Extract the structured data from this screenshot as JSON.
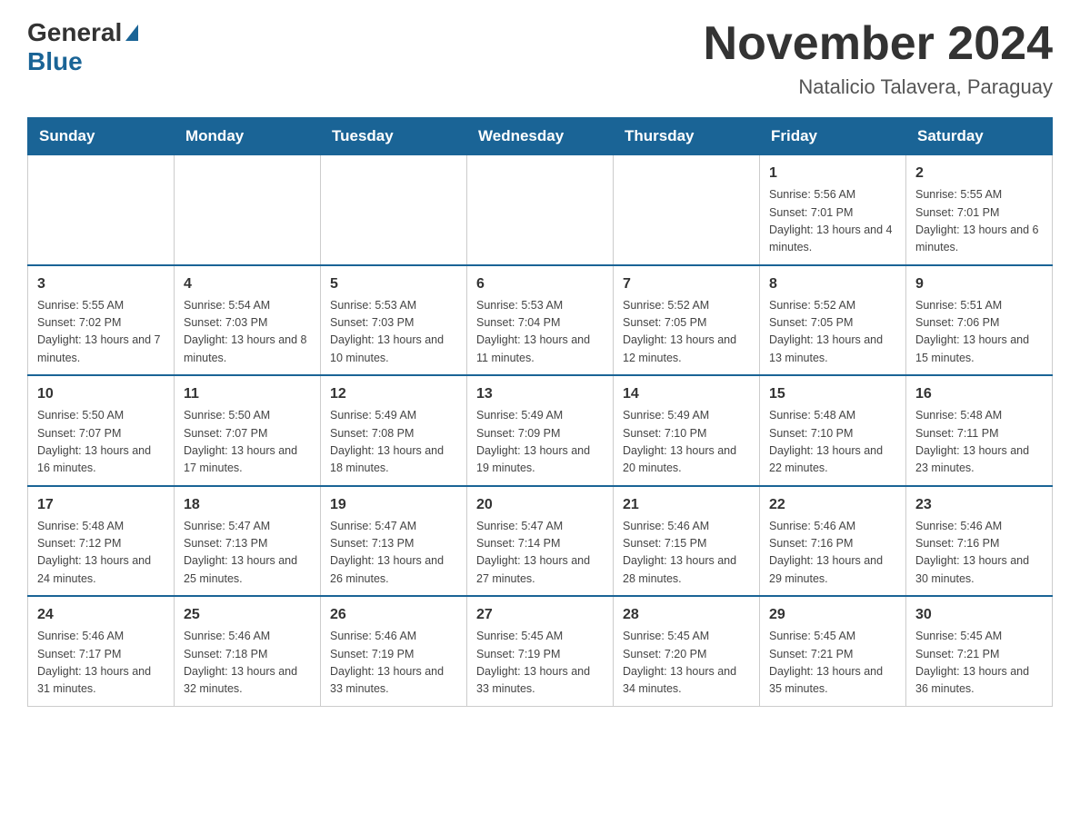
{
  "header": {
    "logo_general": "General",
    "logo_blue": "Blue",
    "month_title": "November 2024",
    "location": "Natalicio Talavera, Paraguay"
  },
  "calendar": {
    "days_of_week": [
      "Sunday",
      "Monday",
      "Tuesday",
      "Wednesday",
      "Thursday",
      "Friday",
      "Saturday"
    ],
    "weeks": [
      [
        {
          "day": "",
          "info": ""
        },
        {
          "day": "",
          "info": ""
        },
        {
          "day": "",
          "info": ""
        },
        {
          "day": "",
          "info": ""
        },
        {
          "day": "",
          "info": ""
        },
        {
          "day": "1",
          "info": "Sunrise: 5:56 AM\nSunset: 7:01 PM\nDaylight: 13 hours and 4 minutes."
        },
        {
          "day": "2",
          "info": "Sunrise: 5:55 AM\nSunset: 7:01 PM\nDaylight: 13 hours and 6 minutes."
        }
      ],
      [
        {
          "day": "3",
          "info": "Sunrise: 5:55 AM\nSunset: 7:02 PM\nDaylight: 13 hours and 7 minutes."
        },
        {
          "day": "4",
          "info": "Sunrise: 5:54 AM\nSunset: 7:03 PM\nDaylight: 13 hours and 8 minutes."
        },
        {
          "day": "5",
          "info": "Sunrise: 5:53 AM\nSunset: 7:03 PM\nDaylight: 13 hours and 10 minutes."
        },
        {
          "day": "6",
          "info": "Sunrise: 5:53 AM\nSunset: 7:04 PM\nDaylight: 13 hours and 11 minutes."
        },
        {
          "day": "7",
          "info": "Sunrise: 5:52 AM\nSunset: 7:05 PM\nDaylight: 13 hours and 12 minutes."
        },
        {
          "day": "8",
          "info": "Sunrise: 5:52 AM\nSunset: 7:05 PM\nDaylight: 13 hours and 13 minutes."
        },
        {
          "day": "9",
          "info": "Sunrise: 5:51 AM\nSunset: 7:06 PM\nDaylight: 13 hours and 15 minutes."
        }
      ],
      [
        {
          "day": "10",
          "info": "Sunrise: 5:50 AM\nSunset: 7:07 PM\nDaylight: 13 hours and 16 minutes."
        },
        {
          "day": "11",
          "info": "Sunrise: 5:50 AM\nSunset: 7:07 PM\nDaylight: 13 hours and 17 minutes."
        },
        {
          "day": "12",
          "info": "Sunrise: 5:49 AM\nSunset: 7:08 PM\nDaylight: 13 hours and 18 minutes."
        },
        {
          "day": "13",
          "info": "Sunrise: 5:49 AM\nSunset: 7:09 PM\nDaylight: 13 hours and 19 minutes."
        },
        {
          "day": "14",
          "info": "Sunrise: 5:49 AM\nSunset: 7:10 PM\nDaylight: 13 hours and 20 minutes."
        },
        {
          "day": "15",
          "info": "Sunrise: 5:48 AM\nSunset: 7:10 PM\nDaylight: 13 hours and 22 minutes."
        },
        {
          "day": "16",
          "info": "Sunrise: 5:48 AM\nSunset: 7:11 PM\nDaylight: 13 hours and 23 minutes."
        }
      ],
      [
        {
          "day": "17",
          "info": "Sunrise: 5:48 AM\nSunset: 7:12 PM\nDaylight: 13 hours and 24 minutes."
        },
        {
          "day": "18",
          "info": "Sunrise: 5:47 AM\nSunset: 7:13 PM\nDaylight: 13 hours and 25 minutes."
        },
        {
          "day": "19",
          "info": "Sunrise: 5:47 AM\nSunset: 7:13 PM\nDaylight: 13 hours and 26 minutes."
        },
        {
          "day": "20",
          "info": "Sunrise: 5:47 AM\nSunset: 7:14 PM\nDaylight: 13 hours and 27 minutes."
        },
        {
          "day": "21",
          "info": "Sunrise: 5:46 AM\nSunset: 7:15 PM\nDaylight: 13 hours and 28 minutes."
        },
        {
          "day": "22",
          "info": "Sunrise: 5:46 AM\nSunset: 7:16 PM\nDaylight: 13 hours and 29 minutes."
        },
        {
          "day": "23",
          "info": "Sunrise: 5:46 AM\nSunset: 7:16 PM\nDaylight: 13 hours and 30 minutes."
        }
      ],
      [
        {
          "day": "24",
          "info": "Sunrise: 5:46 AM\nSunset: 7:17 PM\nDaylight: 13 hours and 31 minutes."
        },
        {
          "day": "25",
          "info": "Sunrise: 5:46 AM\nSunset: 7:18 PM\nDaylight: 13 hours and 32 minutes."
        },
        {
          "day": "26",
          "info": "Sunrise: 5:46 AM\nSunset: 7:19 PM\nDaylight: 13 hours and 33 minutes."
        },
        {
          "day": "27",
          "info": "Sunrise: 5:45 AM\nSunset: 7:19 PM\nDaylight: 13 hours and 33 minutes."
        },
        {
          "day": "28",
          "info": "Sunrise: 5:45 AM\nSunset: 7:20 PM\nDaylight: 13 hours and 34 minutes."
        },
        {
          "day": "29",
          "info": "Sunrise: 5:45 AM\nSunset: 7:21 PM\nDaylight: 13 hours and 35 minutes."
        },
        {
          "day": "30",
          "info": "Sunrise: 5:45 AM\nSunset: 7:21 PM\nDaylight: 13 hours and 36 minutes."
        }
      ]
    ]
  }
}
